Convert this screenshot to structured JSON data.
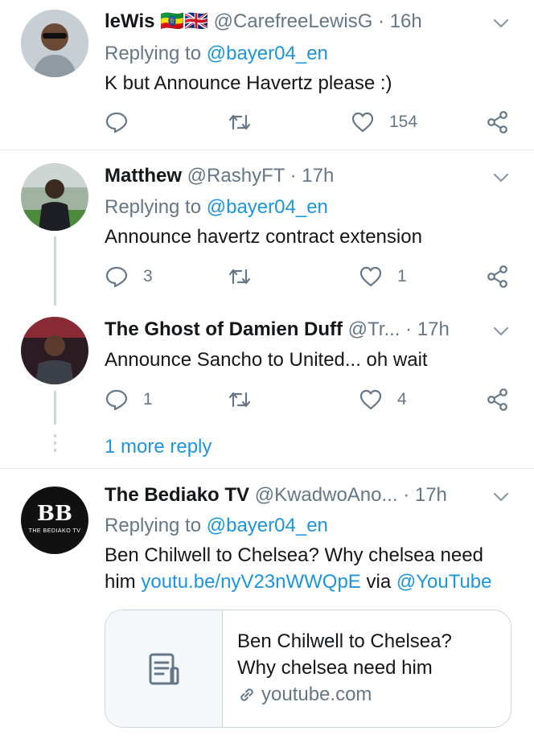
{
  "tweets": [
    {
      "name": "leWis",
      "flags": "🇪🇹🇬🇧",
      "handle": "@CarefreeLewisG",
      "time": "16h",
      "replying_prefix": "Replying to ",
      "replying_handle": "@bayer04_en",
      "text": "K but Announce Havertz please :)",
      "replies": "",
      "retweets": "",
      "likes": "154"
    },
    {
      "name": "Matthew",
      "handle": "@RashyFT",
      "time": "17h",
      "replying_prefix": "Replying to ",
      "replying_handle": "@bayer04_en",
      "text": "Announce havertz contract extension",
      "replies": "3",
      "retweets": "",
      "likes": "1"
    },
    {
      "name": "The Ghost of Damien Duff",
      "handle": "@Tr...",
      "time": "17h",
      "text": "Announce Sancho to United... oh wait",
      "replies": "1",
      "retweets": "",
      "likes": "4"
    },
    {
      "name": "The Bediako TV",
      "handle": "@KwadwoAno...",
      "time": "17h",
      "replying_prefix": "Replying to ",
      "replying_handle": "@bayer04_en",
      "text_part1": "Ben Chilwell to Chelsea? Why chelsea need",
      "text_part2": "him ",
      "link": "youtu.be/nyV23nWWQpE",
      "via": " via ",
      "via_handle": "@YouTube",
      "avatar_text": "BB",
      "avatar_subtext": "THE BEDIAKO TV"
    }
  ],
  "more_reply": "1 more reply",
  "card": {
    "title_line1": "Ben Chilwell to Chelsea?",
    "title_line2": "Why chelsea need him",
    "domain": "youtube.com"
  },
  "colors": {
    "link": "#1b95e0",
    "muted": "#657786",
    "divider": "#e1e8ed"
  }
}
